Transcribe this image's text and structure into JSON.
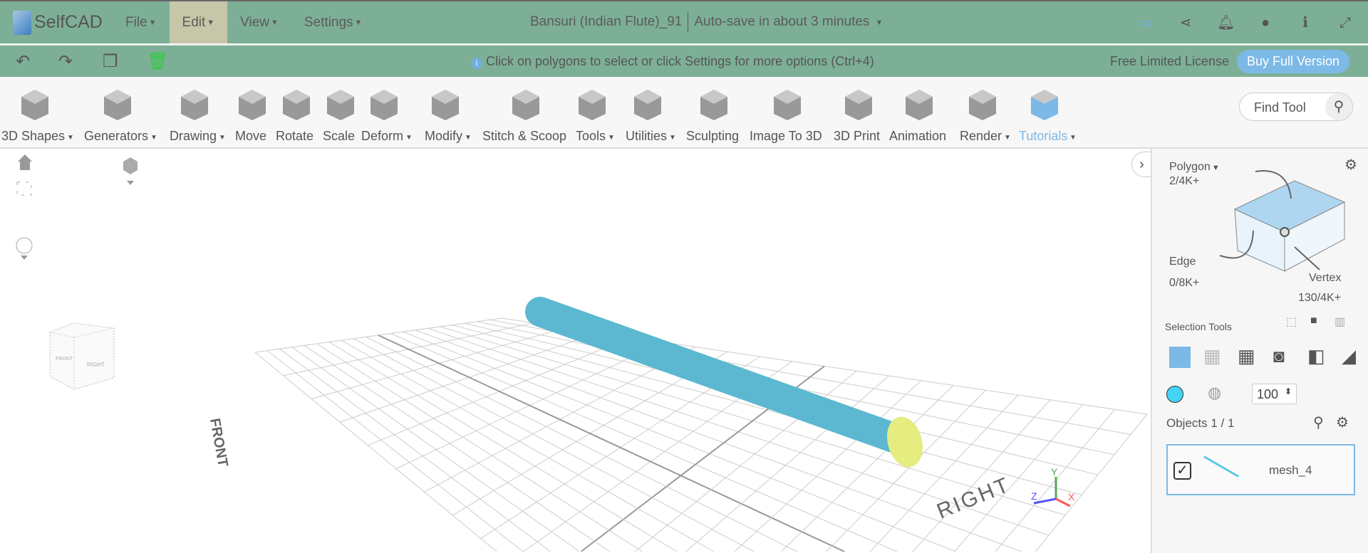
{
  "app": {
    "name": "SelfCAD"
  },
  "menu": [
    {
      "label": "File"
    },
    {
      "label": "Edit"
    },
    {
      "label": "View"
    },
    {
      "label": "Settings"
    }
  ],
  "project": {
    "title": "Bansuri (Indian Flute)_91",
    "autosave": "Auto-save in about 3 minutes"
  },
  "header_icons": [
    "save-icon",
    "share-icon",
    "bell-icon",
    "user-icon",
    "info-icon",
    "fullscreen-icon"
  ],
  "hint": "Click on polygons to select or click Settings for more options (Ctrl+4)",
  "license": "Free Limited License",
  "buy_label": "Buy Full Version",
  "tools": [
    {
      "label": "3D Shapes",
      "dropdown": true
    },
    {
      "label": "Generators",
      "dropdown": true
    },
    {
      "label": "Drawing",
      "dropdown": true
    },
    {
      "label": "Move"
    },
    {
      "label": "Rotate"
    },
    {
      "label": "Scale"
    },
    {
      "label": "Deform",
      "dropdown": true
    },
    {
      "label": "Modify",
      "dropdown": true
    },
    {
      "label": "Stitch & Scoop"
    },
    {
      "label": "Tools",
      "dropdown": true
    },
    {
      "label": "Utilities",
      "dropdown": true
    },
    {
      "label": "Sculpting"
    },
    {
      "label": "Image To 3D"
    },
    {
      "label": "3D Print"
    },
    {
      "label": "Animation"
    },
    {
      "label": "Render",
      "dropdown": true
    },
    {
      "label": "Tutorials",
      "dropdown": true
    }
  ],
  "find_tool": "Find Tool",
  "viewcube": {
    "front": "FRONT",
    "right": "RIGHT"
  },
  "scene": {
    "front_label": "FRONT",
    "right_label": "RIGHT",
    "axes": {
      "x": "X",
      "y": "Y",
      "z": "Z"
    },
    "cylinder_color": "#5bb8d0",
    "cap_color": "#e5ec80"
  },
  "panel": {
    "polygon": {
      "label": "Polygon",
      "count": "2/4K+"
    },
    "edge": {
      "label": "Edge",
      "count": "0/8K+"
    },
    "vertex": {
      "label": "Vertex",
      "count": "130/4K+"
    },
    "selection_tools": "Selection Tools",
    "color": "#44d4f5",
    "opacity": "100",
    "objects_label": "Objects 1 / 1",
    "objects": [
      {
        "name": "mesh_4",
        "checked": true
      }
    ]
  }
}
